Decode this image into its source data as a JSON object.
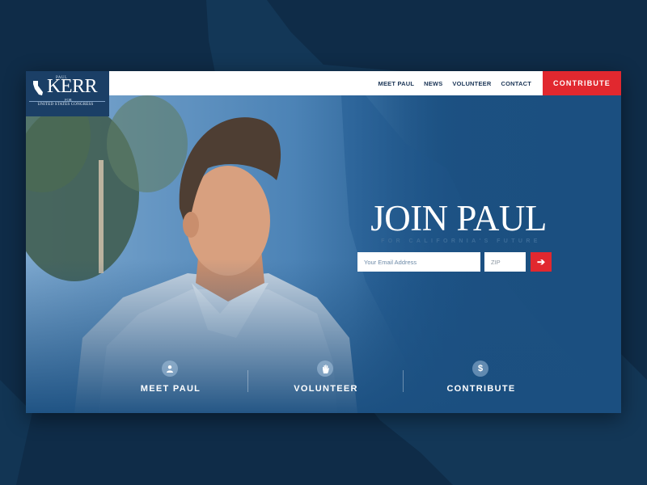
{
  "brand": {
    "first_name": "PAUL",
    "name": "KERR",
    "for": "FOR",
    "subtitle": "UNITED STATES CONGRESS"
  },
  "nav": {
    "items": [
      {
        "label": "MEET PAUL"
      },
      {
        "label": "NEWS"
      },
      {
        "label": "VOLUNTEER"
      },
      {
        "label": "CONTACT"
      }
    ],
    "contribute_label": "CONTRIBUTE"
  },
  "hero": {
    "title": "JOIN PAUL",
    "subtitle": "FOR CALIFORNIA'S FUTURE",
    "email_placeholder": "Your Email Address",
    "zip_placeholder": "ZIP",
    "submit_symbol": "➔"
  },
  "actions": [
    {
      "label": "MEET PAUL",
      "icon": "person-icon"
    },
    {
      "label": "VOLUNTEER",
      "icon": "hand-icon"
    },
    {
      "label": "CONTRIBUTE",
      "icon": "dollar-icon"
    }
  ],
  "colors": {
    "page_bg": "#0f2c48",
    "hero_blue": "#1b4f80",
    "accent_red": "#e1282f",
    "nav_text": "#1b3556"
  }
}
